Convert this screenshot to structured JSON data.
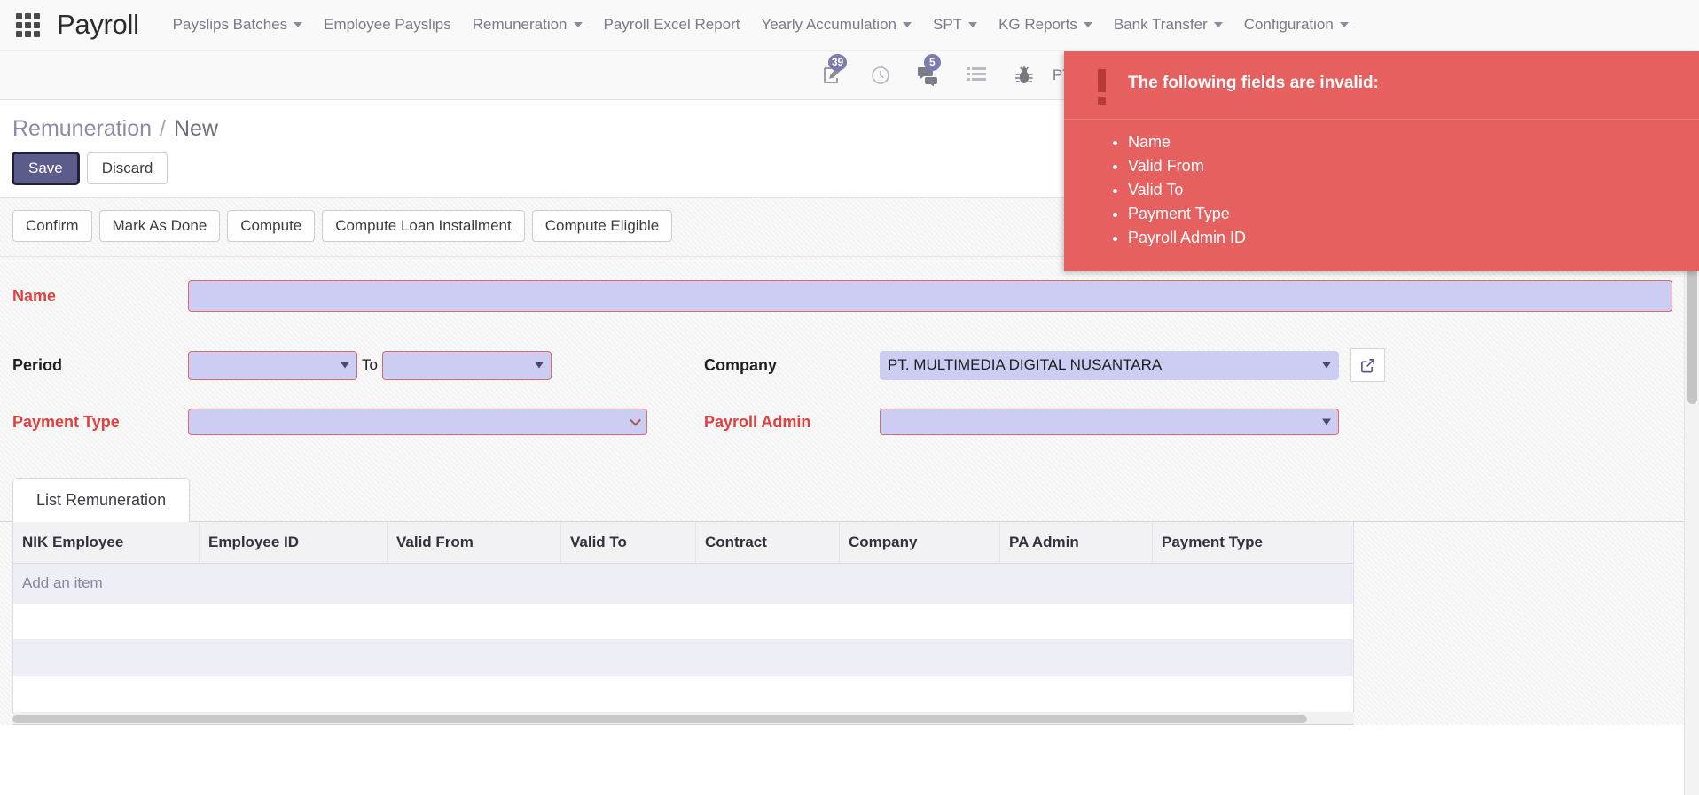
{
  "app": {
    "brand": "Payroll",
    "apps_icon": "apps-grid-icon"
  },
  "nav": {
    "items": [
      {
        "label": "Payslips Batches",
        "has_caret": true
      },
      {
        "label": "Employee Payslips",
        "has_caret": false
      },
      {
        "label": "Remuneration",
        "has_caret": true
      },
      {
        "label": "Payroll Excel Report",
        "has_caret": false
      },
      {
        "label": "Yearly Accumulation",
        "has_caret": true
      },
      {
        "label": "SPT",
        "has_caret": true
      },
      {
        "label": "KG Reports",
        "has_caret": true
      },
      {
        "label": "Bank Transfer",
        "has_caret": true
      },
      {
        "label": "Configuration",
        "has_caret": true
      }
    ]
  },
  "systray": {
    "activity_badge": "39",
    "messages_badge": "5",
    "company": "PT. MULTIMEDIA DIGITAL NUSANTARA"
  },
  "error_panel": {
    "title": "The following fields are invalid:",
    "fields": [
      "Name",
      "Valid From",
      "Valid To",
      "Payment Type",
      "Payroll Admin ID"
    ],
    "bg_color": "#e6605f"
  },
  "breadcrumb": {
    "parent": "Remuneration",
    "separator": "/",
    "current": "New"
  },
  "control_panel": {
    "save_label": "Save",
    "discard_label": "Discard",
    "save_color": "#5b5b8c"
  },
  "actions": [
    {
      "label": "Confirm"
    },
    {
      "label": "Mark As Done"
    },
    {
      "label": "Compute"
    },
    {
      "label": "Compute Loan Installment"
    },
    {
      "label": "Compute Eligible"
    }
  ],
  "form": {
    "name": {
      "label": "Name",
      "value": "",
      "invalid": true
    },
    "period": {
      "label": "Period",
      "from_value": "",
      "to_value": "",
      "to_label": "To",
      "invalid": true
    },
    "payment_type": {
      "label": "Payment Type",
      "value": "",
      "invalid": true
    },
    "company": {
      "label": "Company",
      "value": "PT. MULTIMEDIA DIGITAL NUSANTARA",
      "invalid": false
    },
    "payroll_admin": {
      "label": "Payroll Admin",
      "value": "",
      "invalid": true
    }
  },
  "notebook": {
    "tabs": [
      {
        "label": "List Remuneration",
        "active": true
      }
    ],
    "table": {
      "columns": [
        "NIK Employee",
        "Employee ID",
        "Valid From",
        "Valid To",
        "Contract",
        "Company",
        "PA Admin",
        "Payment Type"
      ],
      "add_item_label": "Add an item",
      "rows": []
    }
  }
}
